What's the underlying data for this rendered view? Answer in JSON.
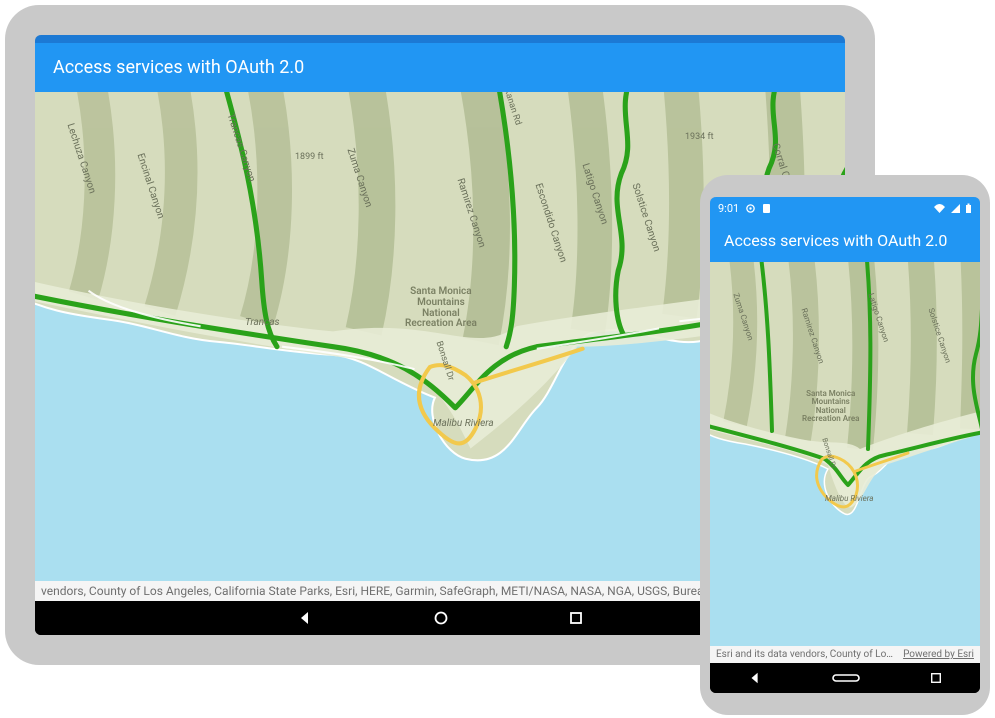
{
  "tablet": {
    "app_title": "Access services with OAuth 2.0",
    "attribution": "vendors, County of Los Angeles, California State Parks, Esri, HERE, Garmin, SafeGraph, METI/NASA, NASA, NGA, USGS, Bureau of L…",
    "map": {
      "labels": {
        "lechuza": "Lechuza Canyon",
        "encinal": "Encinal Canyon",
        "trancas_canyon": "Trancas Canyon",
        "zuma": "Zuma Canyon",
        "ramirez": "Ramirez Canyon",
        "escondido": "Escondido Canyon",
        "latigo": "Latigo Canyon",
        "solstice": "Solstice Canyon",
        "corral": "Corral Canyon",
        "trancas": "Trancas",
        "malibu_riviera": "Malibu Riviera",
        "smm_nra": "Santa Monica\nMountains\nNational\nRecreation Area",
        "bonsall": "Bonsall Dr",
        "kanan": "Kanan Rd",
        "el_1899": "1899 ft",
        "el_1934": "1934 ft"
      }
    }
  },
  "phone": {
    "status_time": "9:01",
    "app_title": "Access services with OAuth 2.0",
    "attribution_left": "Esri and its data vendors, County of Los…",
    "attribution_right": "Powered by Esri",
    "map": {
      "labels": {
        "zuma": "Zuma Canyon",
        "ramirez": "Ramirez Canyon",
        "latigo": "Latigo Canyon",
        "solstice": "Solstice Canyon",
        "malibu_riviera": "Malibu Riviera",
        "bonsall": "Bonsall Dr",
        "smm_nra": "Santa Monica\nMountains\nNational\nRecreation Area"
      }
    }
  },
  "nav": {
    "back": "back",
    "home": "home",
    "recent": "recent"
  }
}
